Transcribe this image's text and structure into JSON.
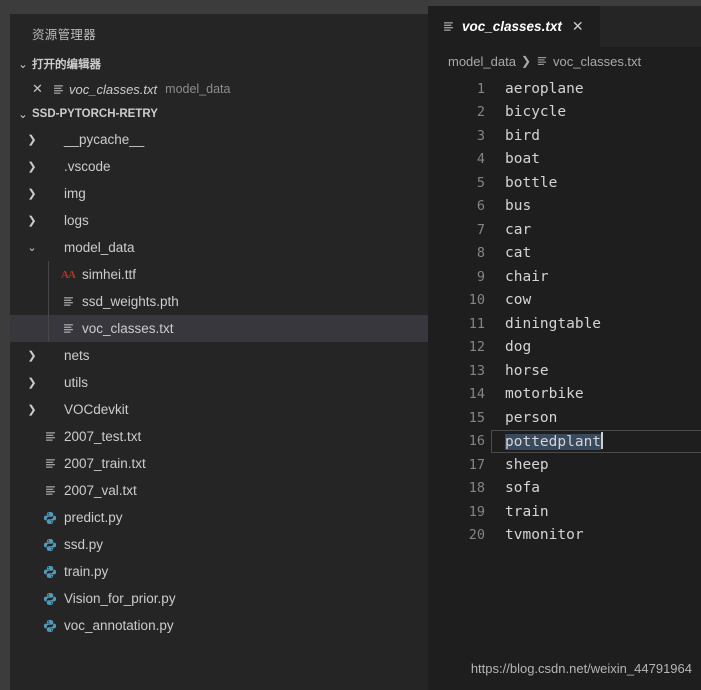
{
  "window": {
    "titlebar_color": "#3c3c3c",
    "sidebar_bg": "#252526",
    "editor_bg": "#1e1e1e",
    "selection_bg": "#37373d",
    "accent_python": "#519aba",
    "accent_font_file": "#b7341f"
  },
  "sidebar": {
    "title": "资源管理器",
    "open_editors": {
      "header_label": "打开的编辑器",
      "twisty": "chevron-down",
      "items": [
        {
          "close_glyph": "✕",
          "icon": "text-file-icon",
          "name": "voc_classes.txt",
          "description": "model_data"
        }
      ]
    },
    "project": {
      "header_label": "SSD-PYTORCH-RETRY",
      "twisty": "chevron-down"
    },
    "tree": [
      {
        "label": "__pycache__",
        "kind": "folder",
        "expanded": false,
        "indent": 1,
        "icon": "chevron-right-icon"
      },
      {
        "label": ".vscode",
        "kind": "folder",
        "expanded": false,
        "indent": 1,
        "icon": "chevron-right-icon"
      },
      {
        "label": "img",
        "kind": "folder",
        "expanded": false,
        "indent": 1,
        "icon": "chevron-right-icon"
      },
      {
        "label": "logs",
        "kind": "folder",
        "expanded": false,
        "indent": 1,
        "icon": "chevron-right-icon"
      },
      {
        "label": "model_data",
        "kind": "folder",
        "expanded": true,
        "indent": 1,
        "icon": "chevron-down-icon"
      },
      {
        "label": "simhei.ttf",
        "kind": "font",
        "indent": 2,
        "icon": "font-file-icon"
      },
      {
        "label": "ssd_weights.pth",
        "kind": "text",
        "indent": 2,
        "icon": "text-file-icon"
      },
      {
        "label": "voc_classes.txt",
        "kind": "text",
        "indent": 2,
        "icon": "text-file-icon",
        "selected": true
      },
      {
        "label": "nets",
        "kind": "folder",
        "expanded": false,
        "indent": 1,
        "icon": "chevron-right-icon"
      },
      {
        "label": "utils",
        "kind": "folder",
        "expanded": false,
        "indent": 1,
        "icon": "chevron-right-icon"
      },
      {
        "label": "VOCdevkit",
        "kind": "folder",
        "expanded": false,
        "indent": 1,
        "icon": "chevron-right-icon"
      },
      {
        "label": "2007_test.txt",
        "kind": "text",
        "indent": 1,
        "icon": "text-file-icon"
      },
      {
        "label": "2007_train.txt",
        "kind": "text",
        "indent": 1,
        "icon": "text-file-icon"
      },
      {
        "label": "2007_val.txt",
        "kind": "text",
        "indent": 1,
        "icon": "text-file-icon"
      },
      {
        "label": "predict.py",
        "kind": "python",
        "indent": 1,
        "icon": "python-file-icon"
      },
      {
        "label": "ssd.py",
        "kind": "python",
        "indent": 1,
        "icon": "python-file-icon"
      },
      {
        "label": "train.py",
        "kind": "python",
        "indent": 1,
        "icon": "python-file-icon"
      },
      {
        "label": "Vision_for_prior.py",
        "kind": "python",
        "indent": 1,
        "icon": "python-file-icon"
      },
      {
        "label": "voc_annotation.py",
        "kind": "python",
        "indent": 1,
        "icon": "python-file-icon"
      }
    ]
  },
  "editor": {
    "tab": {
      "label": "voc_classes.txt",
      "icon": "text-file-icon",
      "close_glyph": "✕",
      "preview_italic": true,
      "active": true
    },
    "breadcrumb": [
      {
        "label": "model_data",
        "icon": null
      },
      {
        "label": "voc_classes.txt",
        "icon": "text-file-icon"
      }
    ],
    "breadcrumb_separator": "❯",
    "lines": [
      {
        "n": 1,
        "text": "aeroplane"
      },
      {
        "n": 2,
        "text": "bicycle"
      },
      {
        "n": 3,
        "text": "bird"
      },
      {
        "n": 4,
        "text": "boat"
      },
      {
        "n": 5,
        "text": "bottle"
      },
      {
        "n": 6,
        "text": "bus"
      },
      {
        "n": 7,
        "text": "car"
      },
      {
        "n": 8,
        "text": "cat"
      },
      {
        "n": 9,
        "text": "chair"
      },
      {
        "n": 10,
        "text": "cow"
      },
      {
        "n": 11,
        "text": "diningtable"
      },
      {
        "n": 12,
        "text": "dog"
      },
      {
        "n": 13,
        "text": "horse"
      },
      {
        "n": 14,
        "text": "motorbike"
      },
      {
        "n": 15,
        "text": "person"
      },
      {
        "n": 16,
        "text": "pottedplant",
        "active": true,
        "selected": true,
        "cursor_at_end": true
      },
      {
        "n": 17,
        "text": "sheep"
      },
      {
        "n": 18,
        "text": "sofa"
      },
      {
        "n": 19,
        "text": "train"
      },
      {
        "n": 20,
        "text": "tvmonitor"
      }
    ]
  },
  "watermark": {
    "text": "https://blog.csdn.net/weixin_44791964"
  }
}
